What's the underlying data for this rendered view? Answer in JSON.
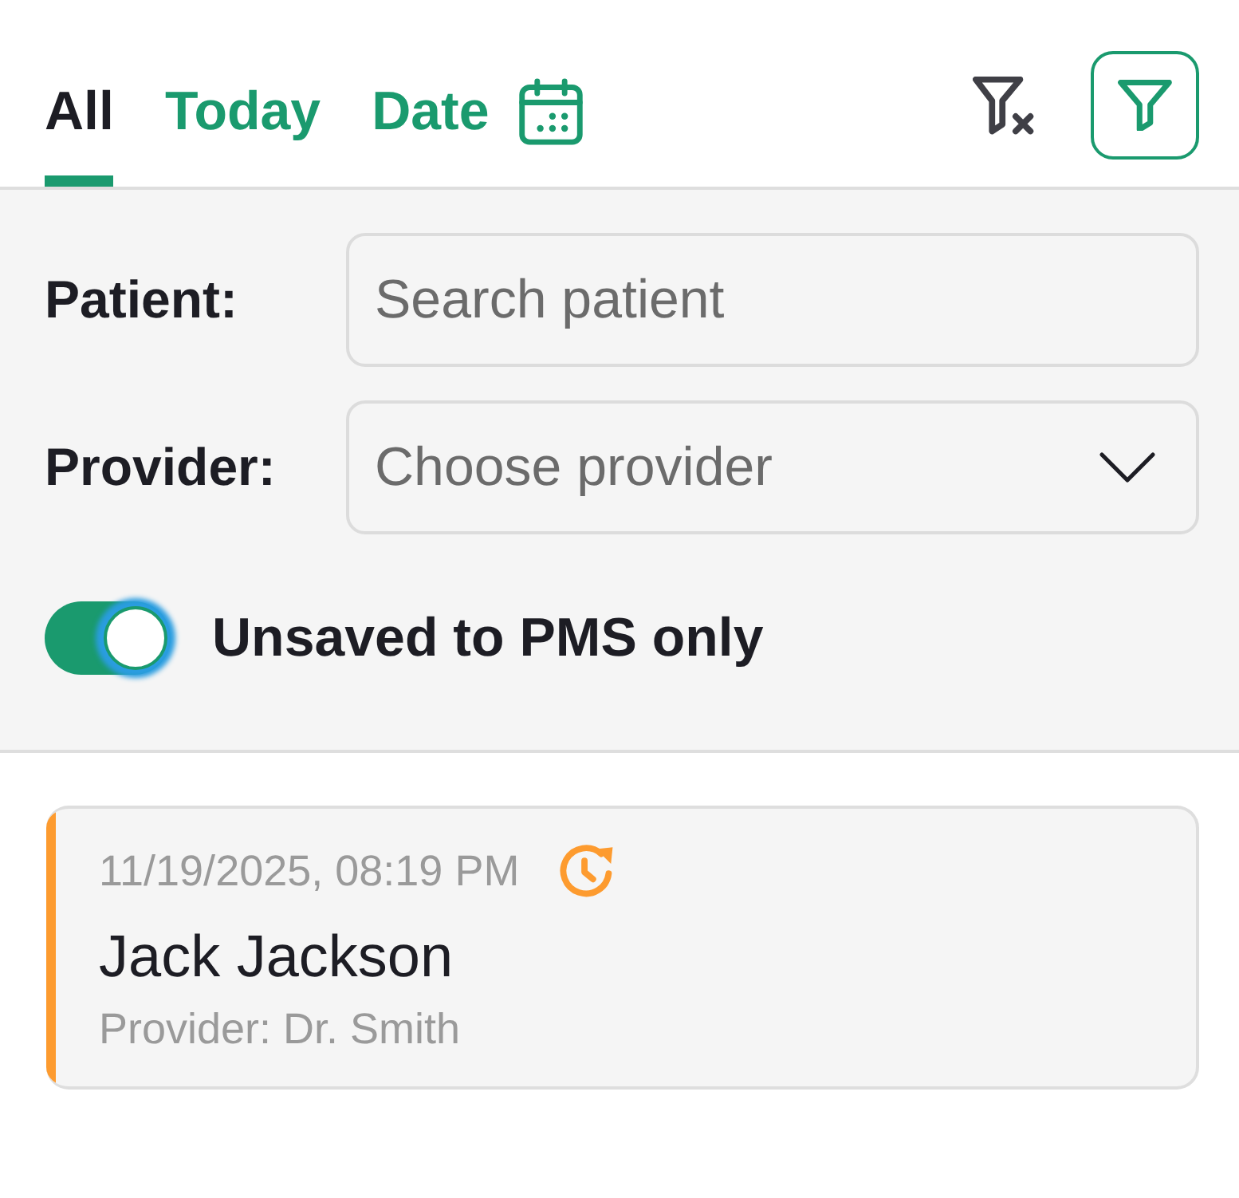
{
  "tabs": [
    {
      "label": "All",
      "kind": "text",
      "selected": true
    },
    {
      "label": "Today",
      "kind": "text",
      "selected": false
    },
    {
      "label": "Date",
      "kind": "date-picker",
      "selected": false
    }
  ],
  "toolbar": [
    {
      "kind": "clear-filter"
    },
    {
      "kind": "filter",
      "selected": true
    }
  ],
  "filters": {
    "fields": [
      {
        "label": "Patient:",
        "kind": "search",
        "placeholder": "Search patient"
      },
      {
        "label": "Provider:",
        "kind": "select",
        "placeholder": "Choose provider"
      }
    ],
    "toggle": {
      "label": "Unsaved to PMS only",
      "on": true,
      "focused": true
    }
  },
  "appointments": [
    {
      "datetime": "11/19/2025, 08:19 PM",
      "pending_sync": true,
      "patient": "Jack Jackson",
      "provider": "Provider: Dr. Smith",
      "color": "#fd9b2f"
    }
  ]
}
